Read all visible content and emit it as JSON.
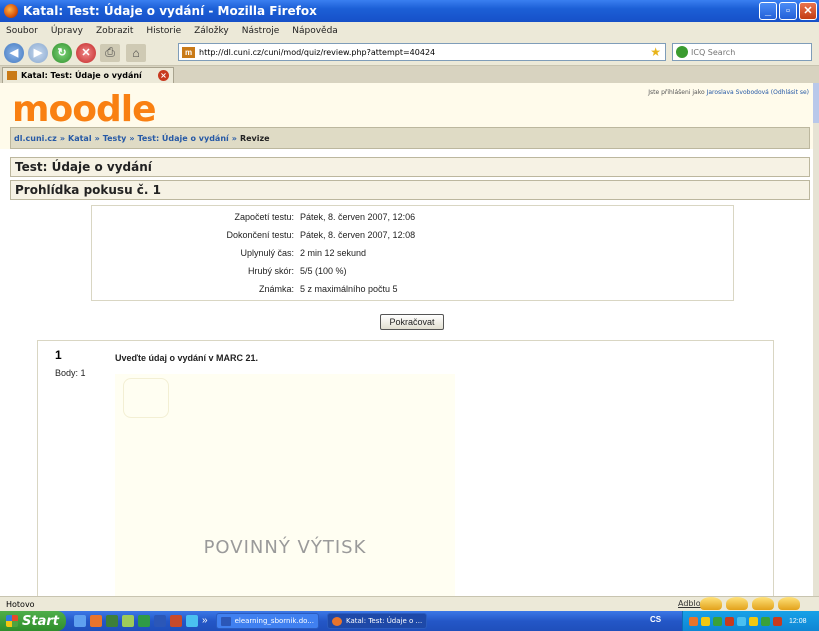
{
  "window": {
    "title": "Katal: Test: Údaje o vydání - Mozilla Firefox",
    "buttons": {
      "minimize": "_",
      "maximize": "▫",
      "close": "✕"
    }
  },
  "menu": [
    "Soubor",
    "Úpravy",
    "Zobrazit",
    "Historie",
    "Záložky",
    "Nástroje",
    "Nápověda"
  ],
  "toolbar": {
    "url": "http://dl.cuni.cz/cuni/mod/quiz/review.php?attempt=40424",
    "favicon": "m",
    "search_placeholder": "ICQ Search"
  },
  "tab": {
    "title": "Katal: Test: Údaje o vydání",
    "close": "×"
  },
  "header": {
    "logo": "moodle",
    "login_prefix": "Jste přihlášeni jako",
    "user": "Jaroslava Svobodová",
    "logout": "(Odhlásit se)"
  },
  "breadcrumb": {
    "items": [
      "dl.cuni.cz",
      "Katal",
      "Testy",
      "Test: Údaje o vydání"
    ],
    "separator": "»",
    "current": "Revize"
  },
  "headings": {
    "test_title": "Test: Údaje o vydání",
    "attempt_title": "Prohlídka pokusu č. 1"
  },
  "attempt": {
    "rows": [
      {
        "label": "Započetí testu:",
        "value": "Pátek, 8. červen 2007, 12:06"
      },
      {
        "label": "Dokončení testu:",
        "value": "Pátek, 8. červen 2007, 12:08"
      },
      {
        "label": "Uplynulý čas:",
        "value": "2 min 12 sekund"
      },
      {
        "label": "Hrubý skór:",
        "value": "5/5 (100 %)"
      },
      {
        "label": "Známka:",
        "value": "5 z maximálního počtu 5"
      }
    ]
  },
  "continue_button": "Pokračovat",
  "question": {
    "number": "1",
    "points": "Body: 1",
    "text": "Uveďte údaj o vydání v MARC 21.",
    "image_text": "POVINNÝ VÝTISK"
  },
  "status": {
    "text": "Hotovo",
    "adblock": "Adblock"
  },
  "taskbar": {
    "start": "Start",
    "more": "»",
    "tasks": [
      "elearning_sbornik.do...",
      "Katal: Test: Údaje o ..."
    ],
    "lang": "CS",
    "clock": "12:08"
  }
}
